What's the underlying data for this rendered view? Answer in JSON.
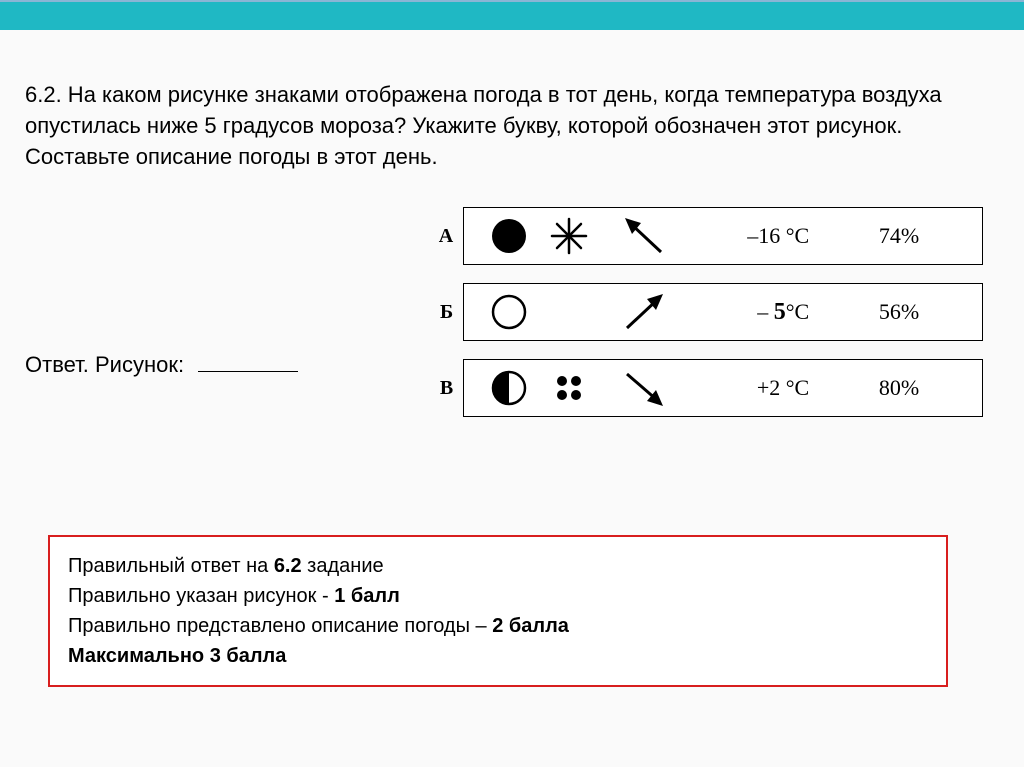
{
  "question": "6.2. На каком рисунке знаками отображена погода в тот день, когда температура воздуха опустилась ниже 5 градусов мороза? Укажите букву, которой обозначен этот рисунок. Составьте описание погоды в этот день.",
  "answerLabel": "Ответ. Рисунок:",
  "rows": [
    {
      "letter": "А",
      "temp": "–16 °C",
      "humidity": "74%"
    },
    {
      "letter": "Б",
      "temp_prefix": "– ",
      "temp_value": "5",
      "temp_suffix": "°C",
      "humidity": "56%"
    },
    {
      "letter": "В",
      "temp": "+2 °C",
      "humidity": "80%"
    }
  ],
  "scoring": {
    "line1_prefix": "Правильный ответ на ",
    "line1_bold": "6.2",
    "line1_suffix": " задание",
    "line2_prefix": "Правильно указан рисунок - ",
    "line2_bold": "1 балл",
    "line3_prefix": "Правильно представлено описание погоды – ",
    "line3_bold": "2 балла",
    "line4_bold": "Максимально 3 балла"
  }
}
